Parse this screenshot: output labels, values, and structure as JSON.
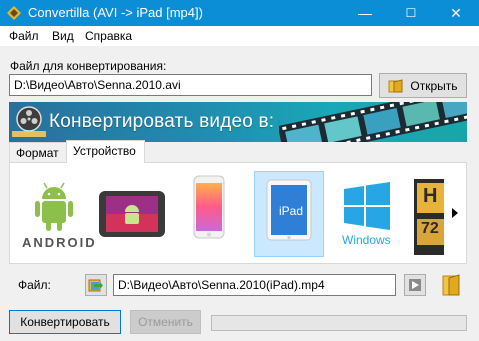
{
  "window": {
    "title": "Convertilla  (AVI -> iPad [mp4])",
    "minimize_glyph": "—",
    "maximize_glyph": "☐",
    "close_glyph": "✕"
  },
  "menu": [
    "Файл",
    "Вид",
    "Справка"
  ],
  "input_section": {
    "label": "Файл для конвертирования:",
    "file_path": "D:\\Видео\\Авто\\Senna.2010.avi",
    "open_button": "Открыть"
  },
  "banner": {
    "text": "Конвертировать видео в:"
  },
  "tabs": [
    {
      "label": "Формат",
      "active": false
    },
    {
      "label": "Устройство",
      "active": true
    }
  ],
  "devices": [
    {
      "name": "android",
      "label": "ANDROID",
      "selected": false
    },
    {
      "name": "android-tablet",
      "label": "",
      "selected": false
    },
    {
      "name": "iphone",
      "label": "",
      "selected": false
    },
    {
      "name": "ipad",
      "label": "iPad",
      "selected": true
    },
    {
      "name": "windows",
      "label": "Windows",
      "selected": false
    },
    {
      "name": "hd-720",
      "label": "H 72",
      "selected": false
    }
  ],
  "output_section": {
    "label": "Файл:",
    "file_path": "D:\\Видео\\Авто\\Senna.2010(iPad).mp4"
  },
  "actions": {
    "convert_button": "Конвертировать",
    "cancel_button": "Отменить",
    "progress": 0
  },
  "colors": {
    "titlebar": "#0b8ed6",
    "selected_device": "#cce8ff",
    "ipad_blue": "#2f7fd6",
    "android_green": "#8cc04b",
    "windows_blue": "#27a6e5"
  }
}
